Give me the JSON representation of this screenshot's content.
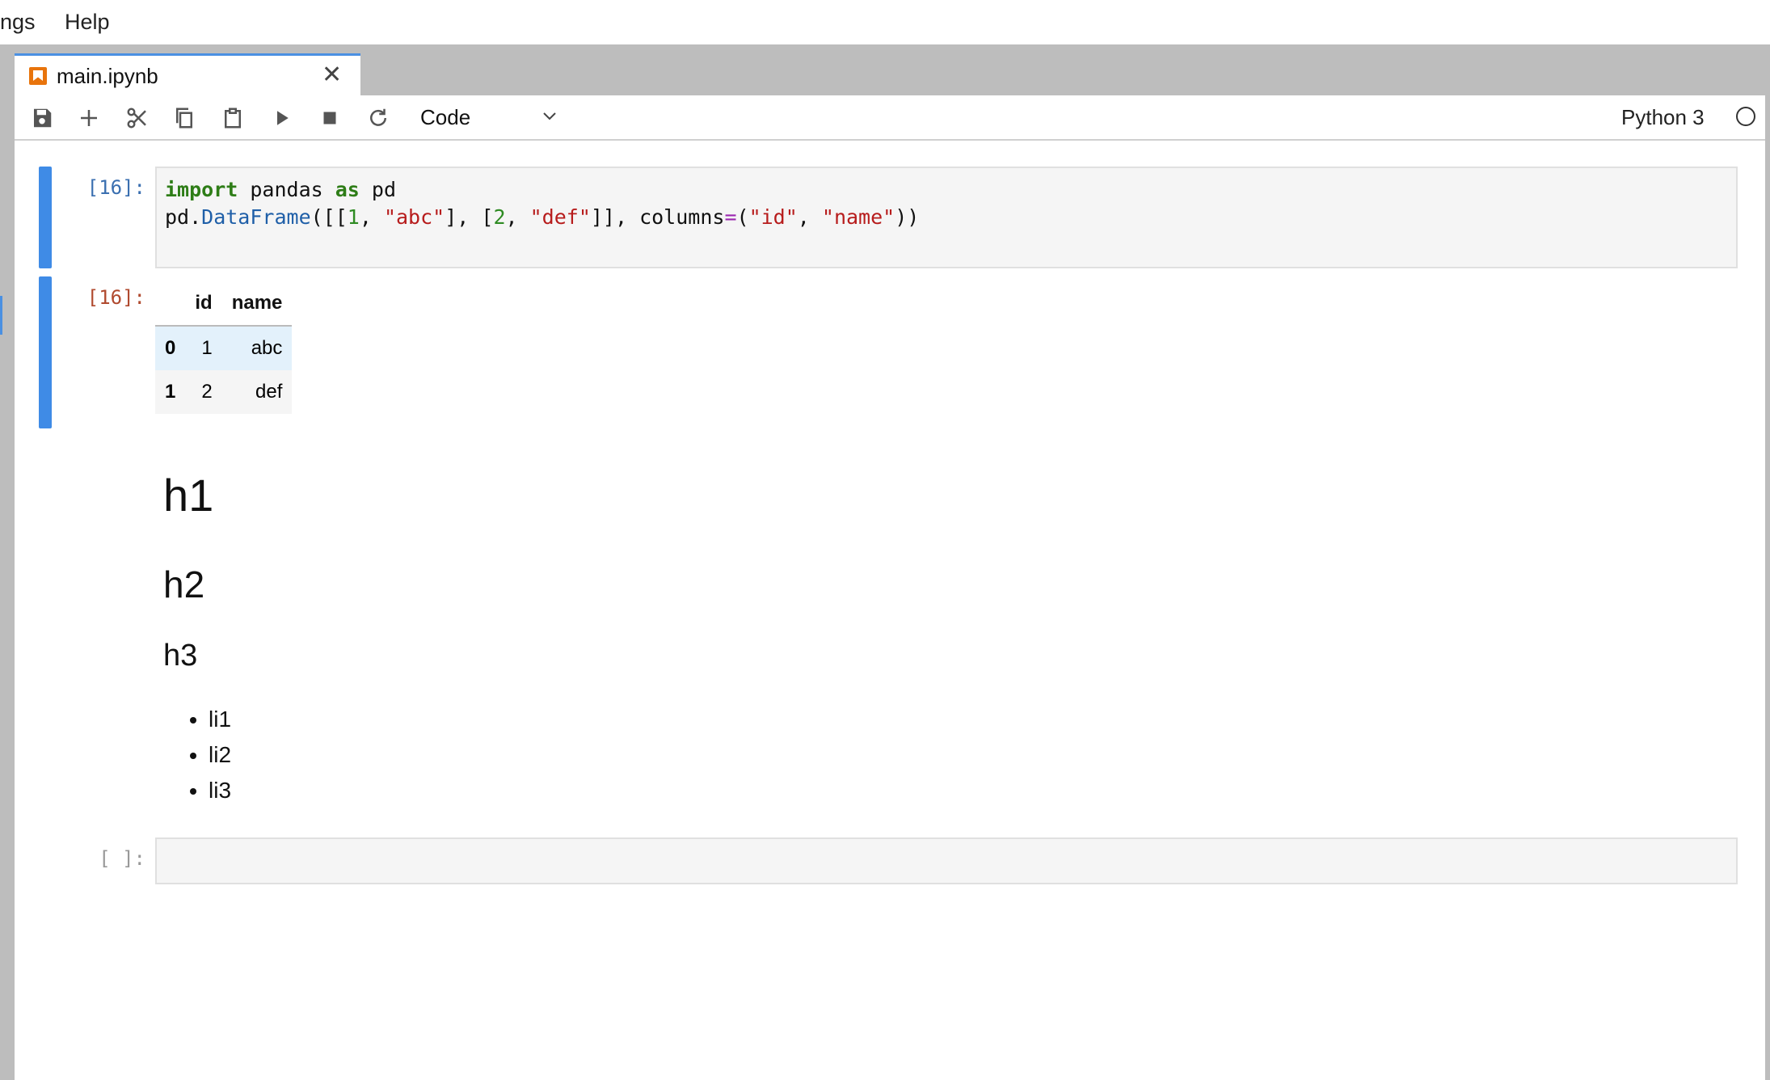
{
  "menubar": {
    "items": [
      "ngs",
      "Help"
    ]
  },
  "tab": {
    "title": "main.ipynb",
    "close_glyph": "✕",
    "icon": "notebook-icon"
  },
  "toolbar": {
    "buttons": [
      "save-icon",
      "add-cell-icon",
      "cut-icon",
      "copy-icon",
      "paste-icon",
      "run-icon",
      "stop-icon",
      "restart-icon"
    ],
    "cell_type": "Code",
    "kernel_name": "Python 3",
    "kernel_status": "idle"
  },
  "cells": {
    "code1": {
      "prompt": "[16]:",
      "lines": [
        "import pandas as pd",
        "pd.DataFrame([[1, \"abc\"], [2, \"def\"]], columns=(\"id\", \"name\"))"
      ]
    },
    "output1": {
      "prompt": "[16]:",
      "columns": [
        "",
        "id",
        "name"
      ],
      "rows": [
        {
          "index": "0",
          "id": "1",
          "name": "abc"
        },
        {
          "index": "1",
          "id": "2",
          "name": "def"
        }
      ]
    },
    "markdown": {
      "h1": "h1",
      "h2": "h2",
      "h3": "h3",
      "list": [
        "li1",
        "li2",
        "li3"
      ]
    },
    "empty": {
      "prompt": "[ ]:"
    }
  },
  "colors": {
    "accent": "#4a90e2",
    "collapser": "#3f8be6",
    "keyword": "#2e7d17",
    "string": "#b71c1c"
  }
}
